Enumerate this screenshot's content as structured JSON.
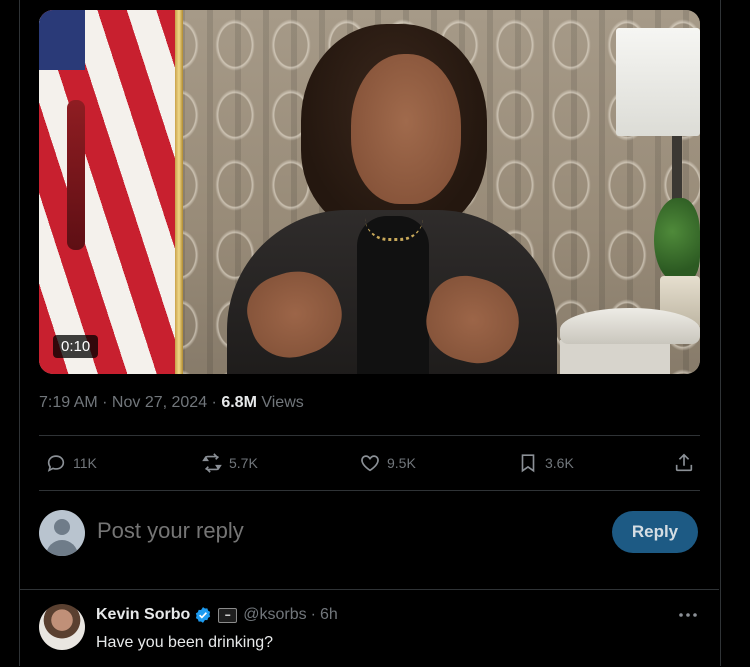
{
  "video": {
    "duration": "0:10"
  },
  "post_meta": {
    "time": "7:19 AM",
    "separator": " · ",
    "date": "Nov 27, 2024",
    "views_count": "6.8M",
    "views_label": " Views"
  },
  "actions": {
    "replies": "11K",
    "reposts": "5.7K",
    "likes": "9.5K",
    "bookmarks": "3.6K",
    "icons": [
      "reply-icon",
      "repost-icon",
      "like-icon",
      "bookmark-icon",
      "share-icon"
    ]
  },
  "reply_composer": {
    "placeholder": "Post your reply",
    "button_label": "Reply",
    "button_color": "#1d5a84"
  },
  "reply_tweet": {
    "author_name": "Kevin Sorbo",
    "handle": "@ksorbs",
    "separator": "·",
    "time": "6h",
    "text": "Have you been drinking?",
    "verified_color": "#1d9bf0"
  },
  "colors": {
    "background": "#000000",
    "text_primary": "#e7e9ea",
    "text_secondary": "#71767b",
    "border": "#2f3336"
  }
}
